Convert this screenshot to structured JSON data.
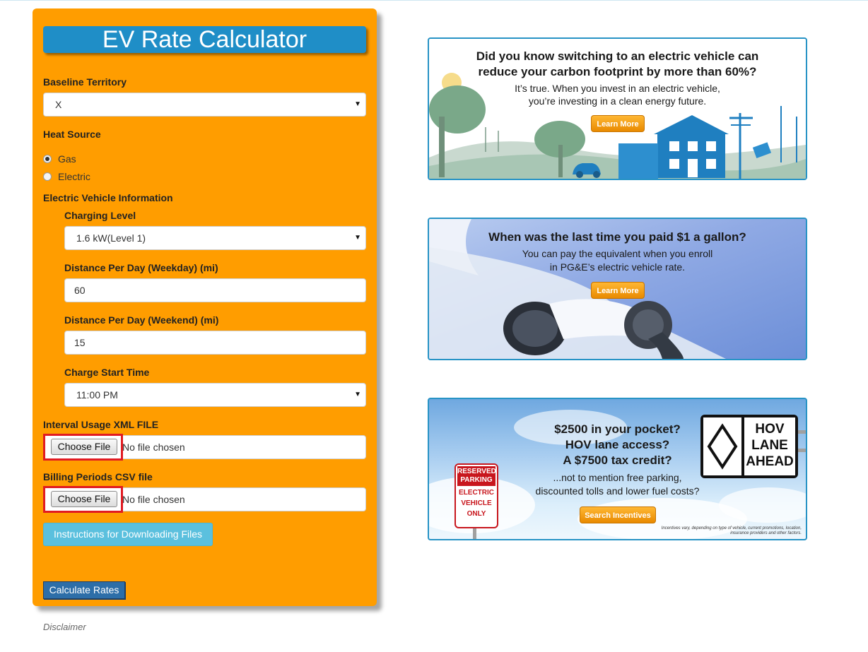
{
  "calculator": {
    "title": "EV Rate Calculator",
    "baseline_territory": {
      "label": "Baseline Territory",
      "value": "X"
    },
    "heat_source": {
      "label": "Heat Source",
      "options": [
        {
          "label": "Gas",
          "checked": true
        },
        {
          "label": "Electric",
          "checked": false
        }
      ]
    },
    "ev_info": {
      "label": "Electric Vehicle Information",
      "charging_level": {
        "label": "Charging Level",
        "value": "1.6 kW(Level 1)"
      },
      "weekday_distance": {
        "label": "Distance Per Day (Weekday) (mi)",
        "value": "60"
      },
      "weekend_distance": {
        "label": "Distance Per Day (Weekend) (mi)",
        "value": "15"
      },
      "charge_start_time": {
        "label": "Charge Start Time",
        "value": "11:00 PM"
      }
    },
    "interval_file": {
      "label": "Interval Usage XML FILE",
      "button": "Choose File",
      "status": "No file chosen"
    },
    "billing_file": {
      "label": "Billing Periods CSV file",
      "button": "Choose File",
      "status": "No file chosen"
    },
    "instructions_button": "Instructions for Downloading Files",
    "calculate_button": "Calculate Rates"
  },
  "disclaimer": "Disclaimer",
  "banners": [
    {
      "headline_1": "Did you know switching to an electric vehicle can",
      "headline_2": "reduce your carbon footprint by more than 60%?",
      "body_1": "It’s true. When you invest in an electric vehicle,",
      "body_2": "you’re investing in a clean energy future.",
      "button": "Learn More"
    },
    {
      "headline_1": "When was the last time you paid $1 a gallon?",
      "body_1": "You can pay the equivalent when you enroll",
      "body_2": "in PG&E’s electric vehicle rate.",
      "button": "Learn More"
    },
    {
      "headline_1": "$2500 in your pocket?",
      "headline_2": "HOV lane access?",
      "headline_3": "A  $7500 tax credit?",
      "body_1": "...not to mention free parking,",
      "body_2": "discounted tolls and lower fuel costs?",
      "button": "Search Incentives",
      "sign_reserved_1": "RESERVED",
      "sign_reserved_2": "PARKING",
      "sign_ev_1": "ELECTRIC",
      "sign_ev_2": "VEHICLE",
      "sign_ev_3": "ONLY",
      "hov_1": "HOV",
      "hov_2": "LANE",
      "hov_3": "AHEAD",
      "fineprint": "Incentives vary, depending on type of vehicle, current promotions, location, insurance providers and other factors."
    }
  ],
  "colors": {
    "panel": "#ff9d00",
    "title_bar": "#1f8ec7",
    "instructions_button": "#5bc0de",
    "calculate_button": "#2d6ea8",
    "file_highlight": "#e11b22",
    "banner_border": "#2793c5"
  }
}
